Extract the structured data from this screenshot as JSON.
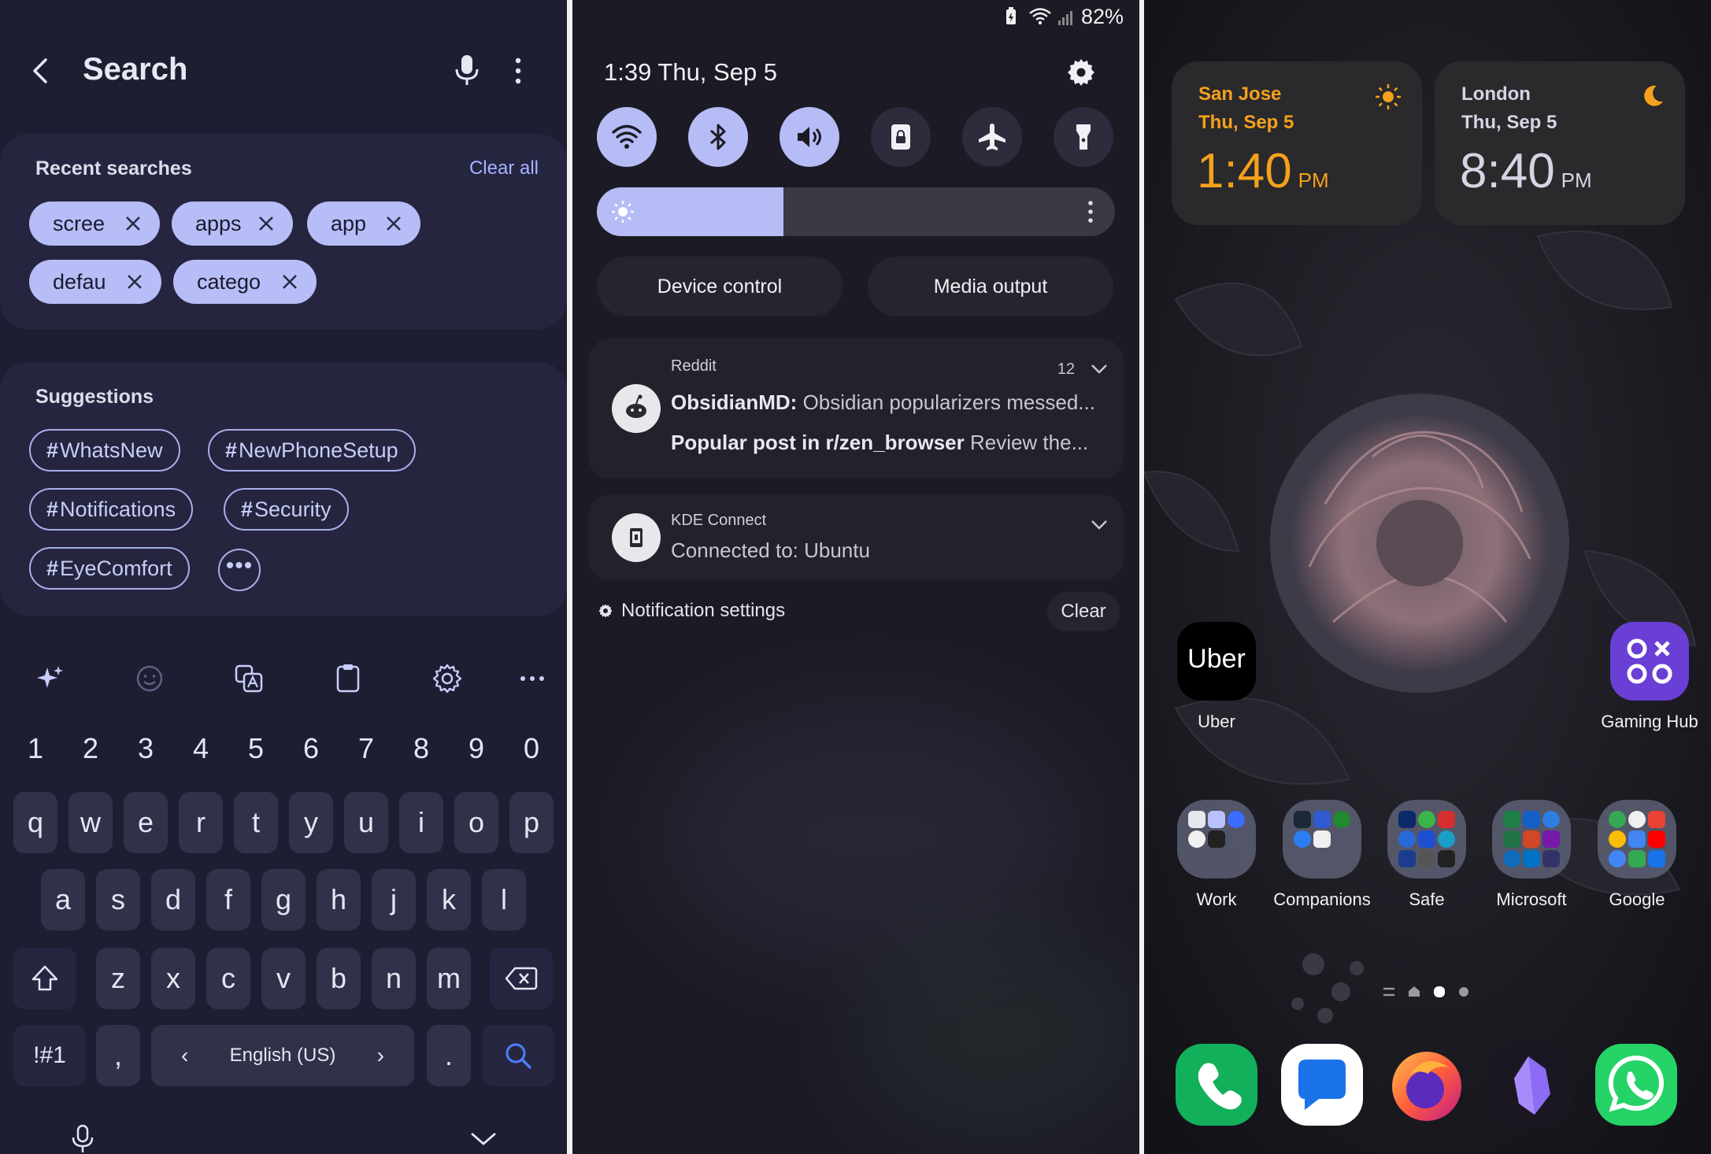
{
  "search": {
    "title": "Search",
    "recent": {
      "title": "Recent searches",
      "clear_label": "Clear all",
      "chips": [
        "scree",
        "apps",
        "app",
        "defau",
        "catego"
      ]
    },
    "suggestions": {
      "title": "Suggestions",
      "tags": [
        "WhatsNew",
        "NewPhoneSetup",
        "Notifications",
        "Security",
        "EyeComfort"
      ],
      "hash": "#",
      "more": "•••"
    },
    "keyboard": {
      "numbers": [
        "1",
        "2",
        "3",
        "4",
        "5",
        "6",
        "7",
        "8",
        "9",
        "0"
      ],
      "row1": [
        "q",
        "w",
        "e",
        "r",
        "t",
        "y",
        "u",
        "i",
        "o",
        "p"
      ],
      "row2": [
        "a",
        "s",
        "d",
        "f",
        "g",
        "h",
        "j",
        "k",
        "l"
      ],
      "row3": [
        "z",
        "x",
        "c",
        "v",
        "b",
        "n",
        "m"
      ],
      "symbols_label": "!#1",
      "comma": ",",
      "period": ".",
      "language": "English (US)",
      "lang_prev": "‹",
      "lang_next": "›"
    }
  },
  "quick_panel": {
    "battery": "82%",
    "time_date": "1:39  Thu, Sep 5",
    "brightness_level": 0.36,
    "device_control": "Device control",
    "media_output": "Media output",
    "notifications": [
      {
        "app": "Reddit",
        "count": "12",
        "line1_bold": "ObsidianMD:",
        "line1": " Obsidian popularizers messed...",
        "line2_bold": "Popular post in r/zen_browser",
        "line2": " Review the..."
      },
      {
        "app": "KDE Connect",
        "line1": "Connected to: Ubuntu"
      }
    ],
    "settings_label": "Notification settings",
    "clear_label": "Clear"
  },
  "home": {
    "clocks": [
      {
        "city": "San Jose",
        "date": "Thu, Sep 5",
        "time": "1:40",
        "ampm": "PM",
        "color": "#f4a11c"
      },
      {
        "city": "London",
        "date": "Thu, Sep 5",
        "time": "8:40",
        "ampm": "PM",
        "color": "#c9c7d8"
      }
    ],
    "apps": {
      "uber": "Uber",
      "uber_logo": "Uber",
      "gaming": "Gaming Hub"
    },
    "folders": [
      "Work",
      "Companions",
      "Safe",
      "Microsoft",
      "Google"
    ],
    "page_indicator": {
      "pages": 4,
      "current": 2
    }
  }
}
